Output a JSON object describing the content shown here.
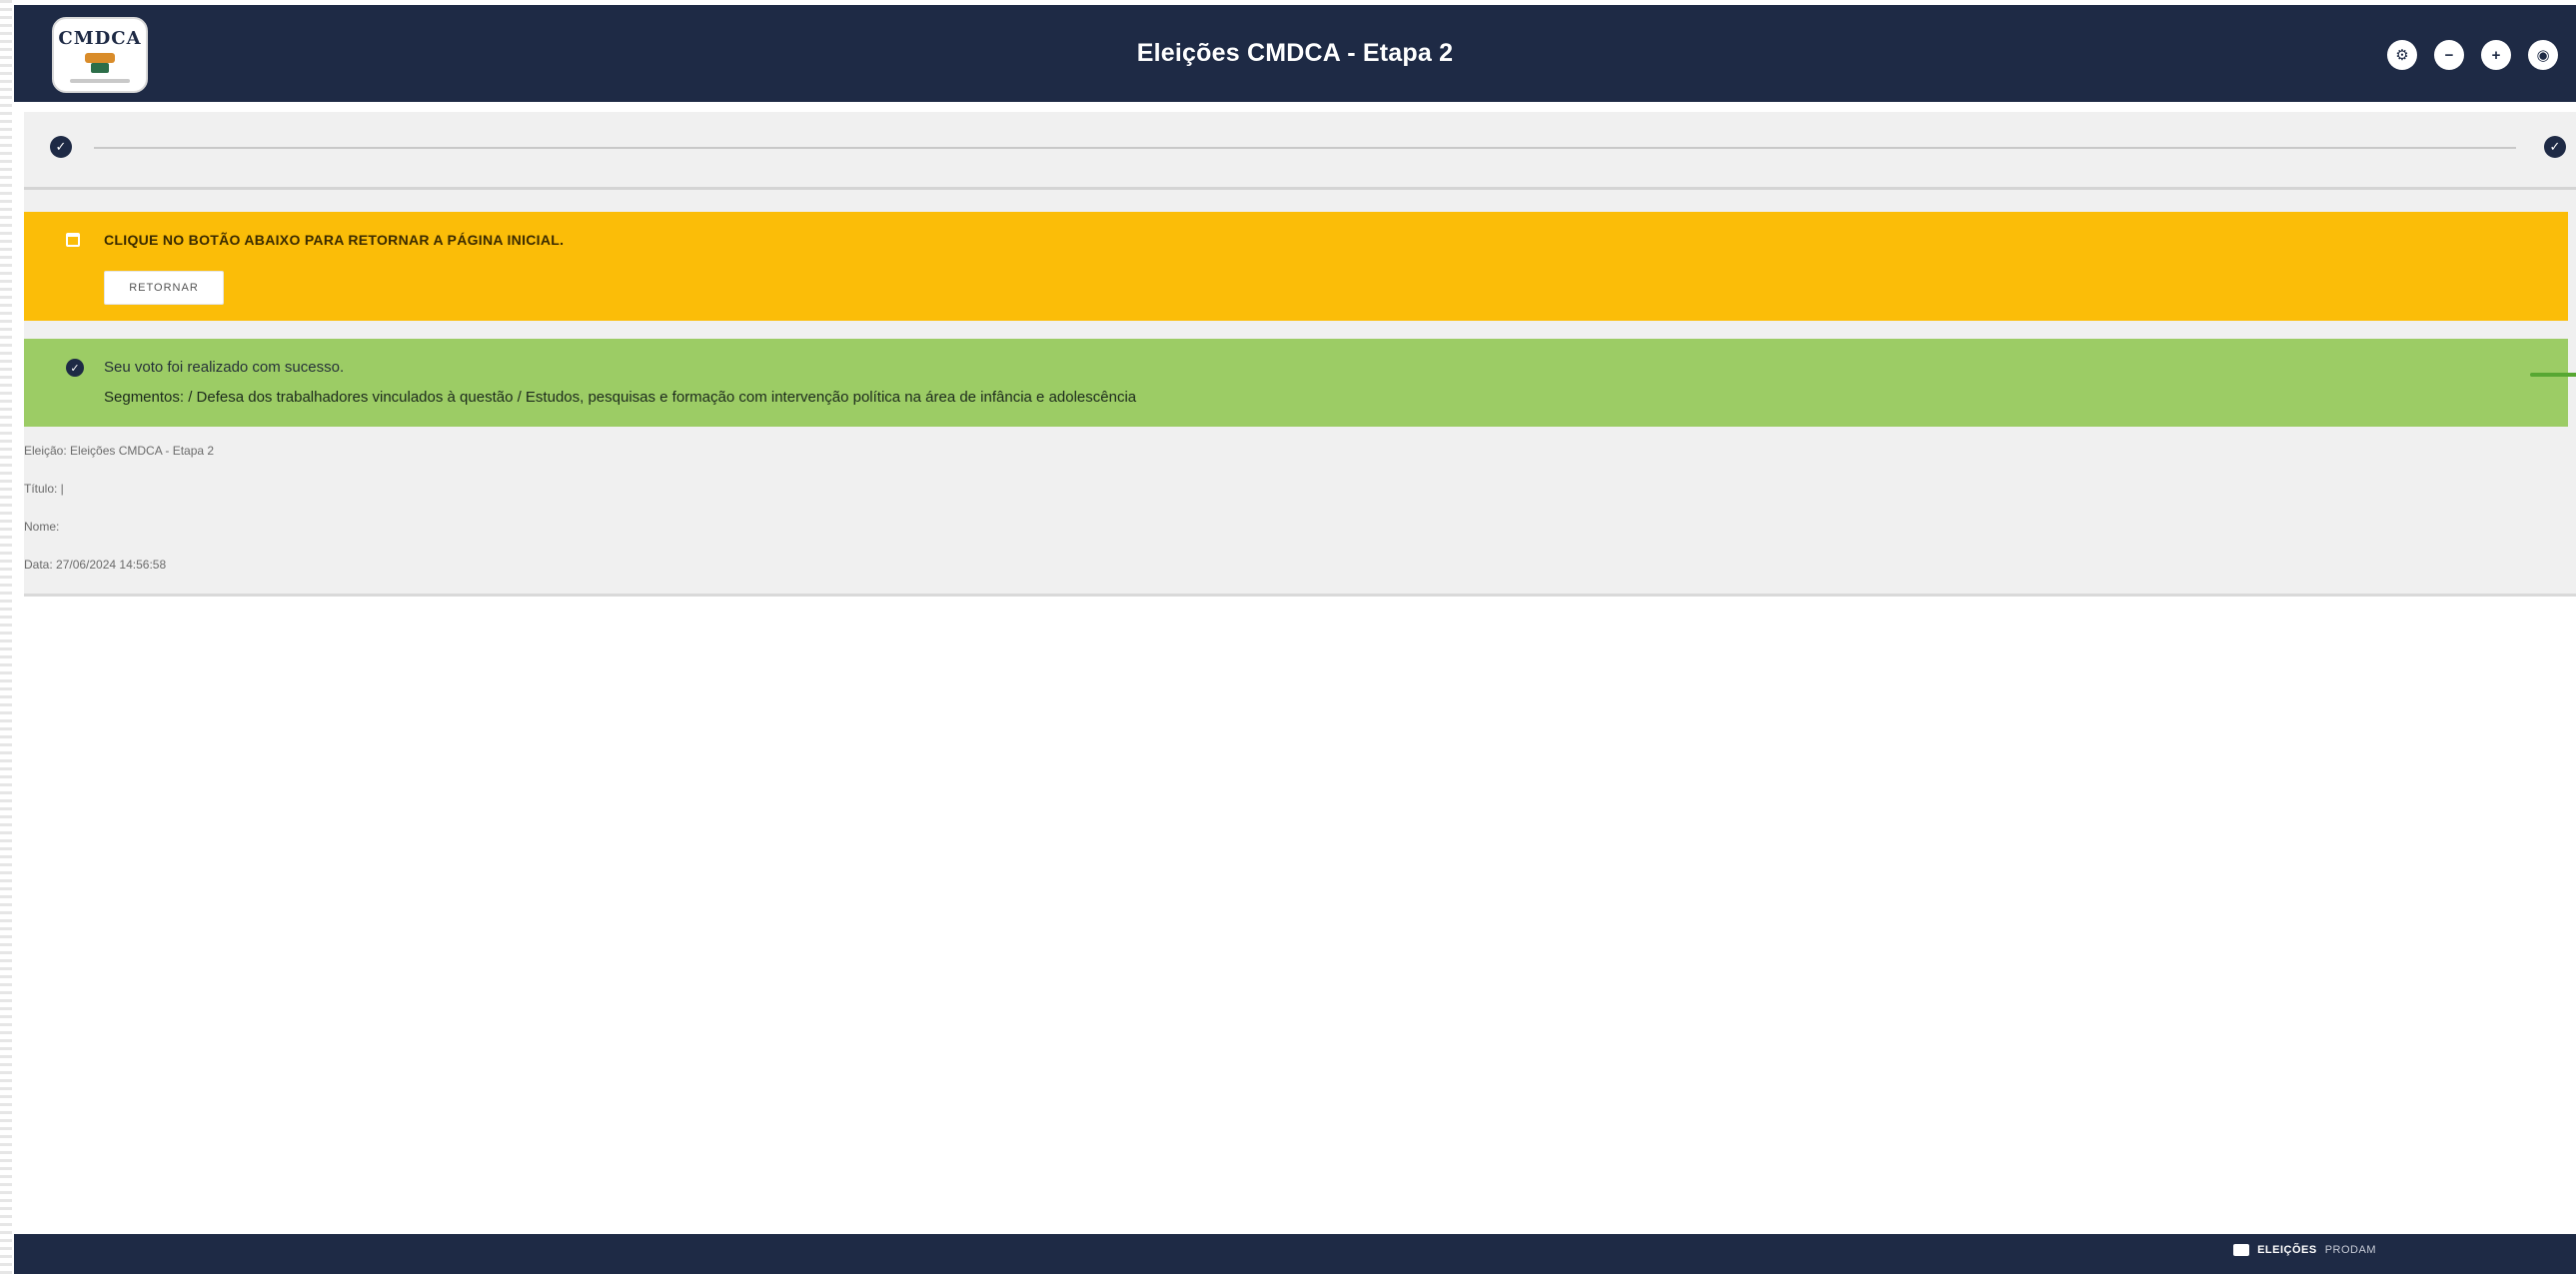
{
  "header": {
    "title": "Eleições CMDCA - Etapa 2",
    "logo_text": "CMDCA",
    "actions": [
      {
        "icon": "settings-icon",
        "glyph": "⚙"
      },
      {
        "icon": "minus-icon",
        "glyph": "−"
      },
      {
        "icon": "plus-icon",
        "glyph": "+"
      },
      {
        "icon": "eye-icon",
        "glyph": "◉"
      }
    ]
  },
  "stepper": {
    "steps": [
      {
        "state": "completed"
      },
      {
        "state": "completed"
      }
    ]
  },
  "warning": {
    "text": "CLIQUE NO BOTÃO ABAIXO PARA RETORNAR A PÁGINA INICIAL.",
    "button_label": "RETORNAR"
  },
  "success": {
    "line1": "Seu voto foi realizado com sucesso.",
    "line2": "Segmentos: / Defesa dos trabalhadores vinculados à questão / Estudos, pesquisas e formação com intervenção política na área de infância e adolescência"
  },
  "details": {
    "eleicao": "Eleição: Eleições CMDCA - Etapa 2",
    "titulo": "Título: |",
    "nome": "Nome:",
    "data": "Data: 27/06/2024 14:56:58"
  },
  "footer": {
    "brand_strong": "ELEIÇÕES",
    "brand_light": "PRODAM"
  },
  "colors": {
    "header_bg": "#1e2a45",
    "warning": "#fbbd08",
    "success": "#9ccc65",
    "panel_bg": "#f0f0f0"
  }
}
